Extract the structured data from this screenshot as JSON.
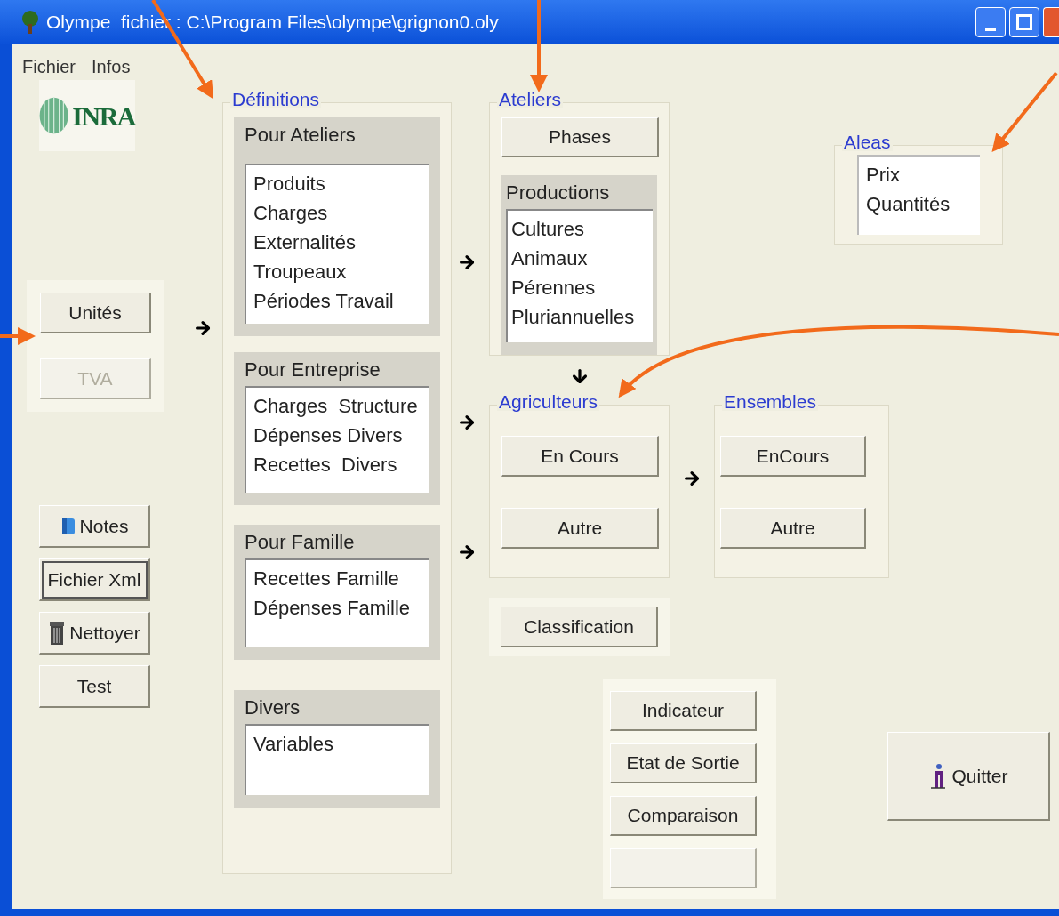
{
  "window": {
    "title": "Olympe  fichier : C:\\Program Files\\olympe\\grignon0.oly"
  },
  "menu": [
    "Fichier",
    "Infos"
  ],
  "logo": {
    "text": "INRA"
  },
  "units": [
    {
      "label": "Unités",
      "disabled": false
    },
    {
      "label": "TVA",
      "disabled": true
    }
  ],
  "tools": [
    {
      "label": "Notes",
      "kind": "notes",
      "focused": false
    },
    {
      "label": "Fichier Xml",
      "kind": "plain",
      "focused": true
    },
    {
      "label": "Nettoyer",
      "kind": "trash",
      "focused": false
    },
    {
      "label": "Test",
      "kind": "plain",
      "focused": false
    }
  ],
  "definitions": {
    "title": "Définitions",
    "panels": [
      {
        "title": "Pour Ateliers",
        "items": [
          "Produits",
          "Charges",
          "Externalités",
          "Troupeaux",
          "Périodes Travail"
        ]
      },
      {
        "title": "Pour Entreprise",
        "items": [
          "Charges  Structure",
          "Dépenses Divers",
          "Recettes  Divers"
        ]
      },
      {
        "title": "Pour Famille",
        "items": [
          "Recettes Famille",
          "Dépenses Famille"
        ]
      },
      {
        "title": "Divers",
        "items": [
          "Variables"
        ]
      }
    ]
  },
  "ateliers": {
    "title": "Ateliers",
    "button": "Phases",
    "productions": {
      "title": "Productions",
      "items": [
        "Cultures",
        "Animaux",
        "Pérennes",
        "Pluriannuelles"
      ]
    }
  },
  "agriculteurs": {
    "title": "Agriculteurs",
    "buttons": [
      "En Cours",
      "Autre"
    ]
  },
  "ensembles": {
    "title": "Ensembles",
    "buttons": [
      "EnCours",
      "Autre"
    ]
  },
  "classification": "Classification",
  "aleas": {
    "title": "Aleas",
    "items": [
      "Prix",
      "Quantités"
    ]
  },
  "outputs": [
    {
      "label": "Indicateur",
      "disabled": false
    },
    {
      "label": "Etat de Sortie",
      "disabled": false
    },
    {
      "label": "Comparaison",
      "disabled": false
    },
    {
      "disabled": true
    }
  ],
  "quit": "Quitter"
}
